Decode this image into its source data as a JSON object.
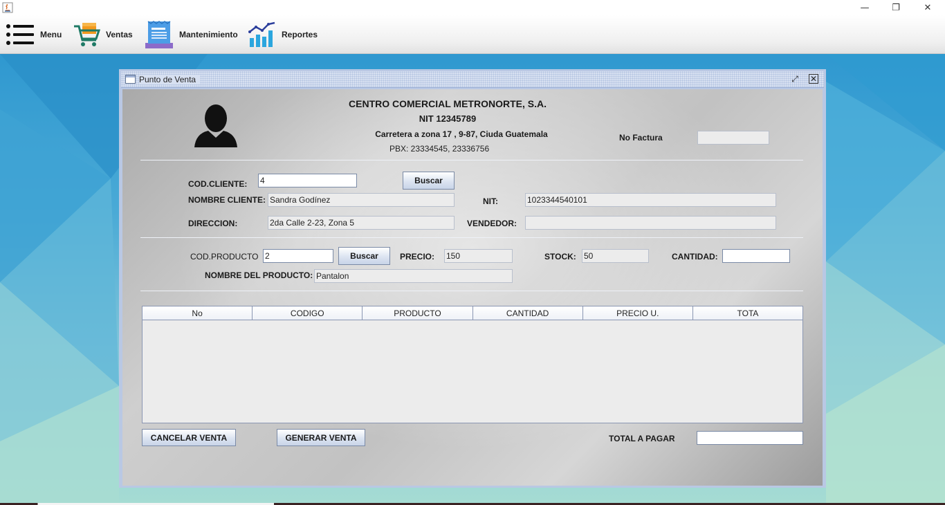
{
  "menubar": {
    "items": [
      {
        "label": "Menu",
        "icon": "hamburger-menu-icon"
      },
      {
        "label": "Ventas",
        "icon": "shopping-cart-icon"
      },
      {
        "label": "Mantenimiento",
        "icon": "document-icon"
      },
      {
        "label": "Reportes",
        "icon": "line-chart-icon"
      }
    ]
  },
  "window": {
    "title": "Punto de Venta"
  },
  "header": {
    "company": "CENTRO COMERCIAL METRONORTE, S.A.",
    "nit": "NIT 12345789",
    "address": "Carretera a zona 17 , 9-87, Ciuda Guatemala",
    "phone": "PBX: 23334545, 23336756",
    "invoice_label": "No Factura",
    "invoice_value": ""
  },
  "cliente": {
    "code_label": "COD.CLIENTE:",
    "code_value": "4",
    "search_button": "Buscar",
    "name_label": "NOMBRE CLIENTE:",
    "name_value": "Sandra Godínez",
    "nit_label": "NIT:",
    "nit_value": "1023344540101",
    "address_label": "DIRECCION:",
    "address_value": "2da Calle 2-23, Zona 5",
    "seller_label": "VENDEDOR:",
    "seller_value": ""
  },
  "producto": {
    "code_label": "COD.PRODUCTO",
    "code_value": "2",
    "search_button": "Buscar",
    "price_label": "PRECIO:",
    "price_value": "150",
    "stock_label": "STOCK:",
    "stock_value": "50",
    "qty_label": "CANTIDAD:",
    "qty_value": "",
    "name_label": "NOMBRE DEL PRODUCTO:",
    "name_value": "Pantalon"
  },
  "table": {
    "columns": [
      "No",
      "CODIGO",
      "PRODUCTO",
      "CANTIDAD",
      "PRECIO U.",
      "TOTA"
    ]
  },
  "footer": {
    "cancel_button": "CANCELAR VENTA",
    "generate_button": "GENERAR VENTA",
    "total_label": "TOTAL A PAGAR",
    "total_value": ""
  },
  "colors": {
    "accent": "#2f98d0",
    "frame_border": "#b9c8e4"
  }
}
